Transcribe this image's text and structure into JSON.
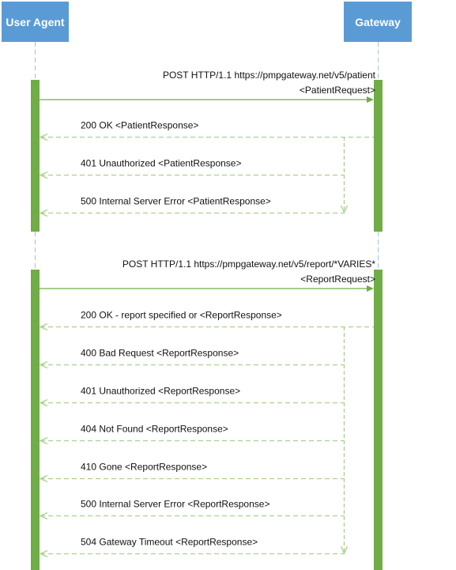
{
  "actors": {
    "user_agent": "User Agent",
    "gateway": "Gateway"
  },
  "colors": {
    "actor": "#5b9bd5",
    "lifeline": "#9dc3e6",
    "activation": "#70ad47",
    "response": "#a9d18e"
  },
  "sections": [
    {
      "request": {
        "line1": "POST HTTP/1.1 https://pmpgateway.net/v5/patient",
        "line2": "<PatientRequest>"
      },
      "responses": [
        "200 OK <PatientResponse>",
        "401 Unauthorized <PatientResponse>",
        "500 Internal Server Error <PatientResponse>"
      ]
    },
    {
      "request": {
        "line1": "POST HTTP/1.1 https://pmpgateway.net/v5/report/*VARIES*",
        "line2": "<ReportRequest>"
      },
      "responses": [
        "200 OK - report specified or <ReportResponse>",
        "400 Bad Request <ReportResponse>",
        "401 Unauthorized <ReportResponse>",
        "404 Not Found <ReportResponse>",
        "410 Gone <ReportResponse>",
        "500 Internal Server Error <ReportResponse>",
        "504 Gateway Timeout <ReportResponse>"
      ]
    }
  ]
}
